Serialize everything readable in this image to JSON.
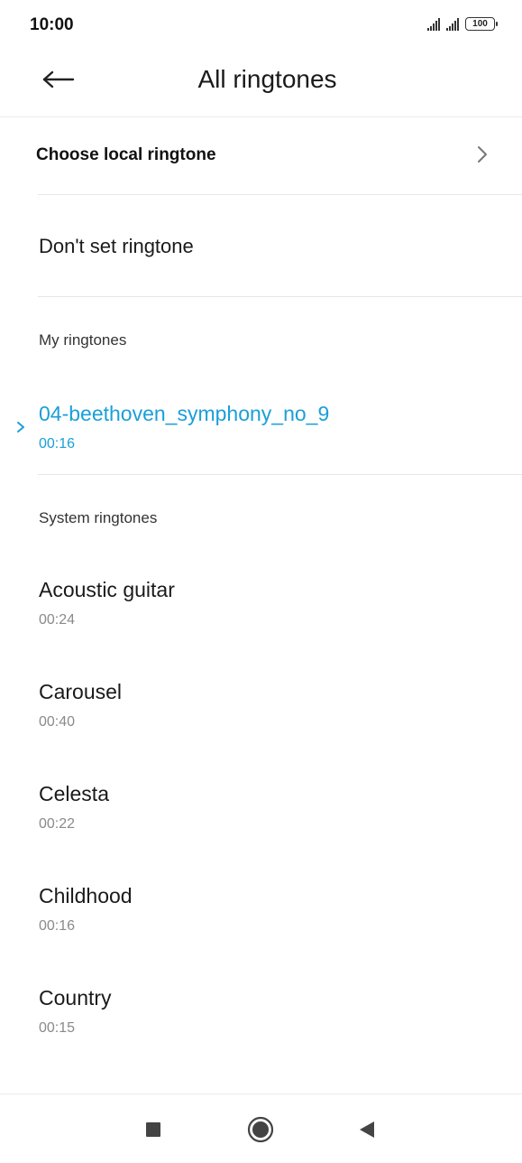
{
  "status": {
    "time": "10:00",
    "battery": "100"
  },
  "header": {
    "title": "All ringtones"
  },
  "local": {
    "label": "Choose local ringtone"
  },
  "no_ringtone": {
    "label": "Don't set ringtone"
  },
  "sections": {
    "my": "My ringtones",
    "system": "System ringtones"
  },
  "my_ringtones": [
    {
      "name": "04-beethoven_symphony_no_9",
      "duration": "00:16",
      "selected": true
    }
  ],
  "system_ringtones": [
    {
      "name": "Acoustic guitar",
      "duration": "00:24"
    },
    {
      "name": "Carousel",
      "duration": "00:40"
    },
    {
      "name": "Celesta",
      "duration": "00:22"
    },
    {
      "name": "Childhood",
      "duration": "00:16"
    },
    {
      "name": "Country",
      "duration": "00:15"
    }
  ],
  "colors": {
    "accent": "#1a9fd9",
    "text": "#1a1a1a",
    "secondary": "#8a8a8a"
  },
  "icons": {
    "back": "arrow-left-icon",
    "chevron": "chevron-right-icon",
    "selected": "chevron-right-icon",
    "nav_recents": "square-icon",
    "nav_home": "circle-icon",
    "nav_back": "triangle-left-icon"
  }
}
